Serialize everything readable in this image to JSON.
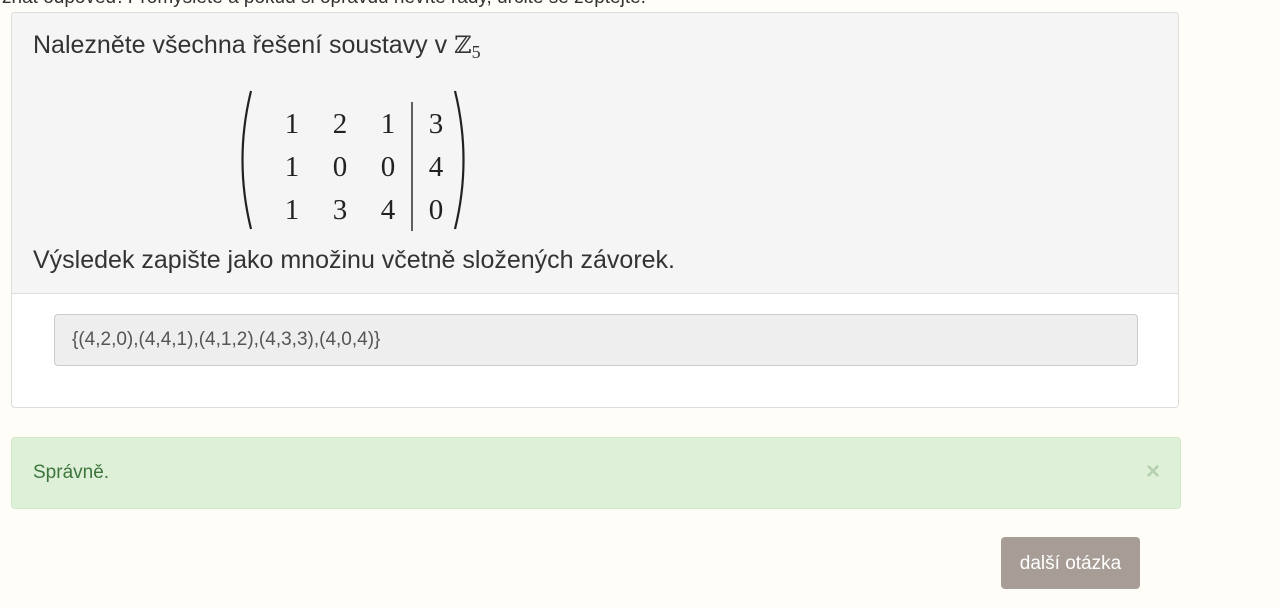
{
  "page": {
    "top_text": "znát odpověď. Promyslete a pokud si opravdu nevíte rady, určitě se zeptejte."
  },
  "question": {
    "title_prefix": "Nalezněte všechna řešení soustavy v ",
    "set_symbol": "ℤ",
    "set_subscript": "5",
    "matrix": [
      [
        "1",
        "2",
        "1",
        "3"
      ],
      [
        "1",
        "0",
        "0",
        "4"
      ],
      [
        "1",
        "3",
        "4",
        "0"
      ]
    ],
    "instructions": "Výsledek zapište jako množinu včetně složených závorek."
  },
  "answer": {
    "value": "{(4,2,0),(4,4,1),(4,1,2),(4,3,3),(4,0,4)}"
  },
  "feedback": {
    "text": "Správně.",
    "close_symbol": "×"
  },
  "actions": {
    "next_label": "další otázka"
  },
  "colors": {
    "background": "#fefdf8",
    "panel_heading": "#f5f5f5",
    "success_bg": "#dff0d8",
    "success_text": "#3c763d",
    "button_bg": "#a79d96"
  }
}
